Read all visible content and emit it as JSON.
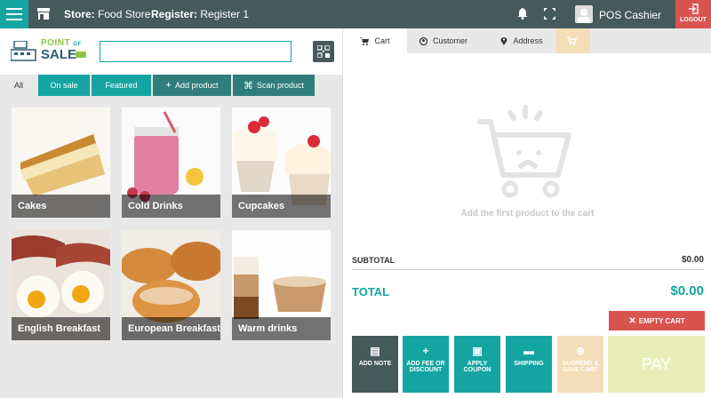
{
  "header": {
    "store_prefix": "Store:",
    "store_name": "Food Store",
    "register_prefix": "Register:",
    "register_name": "Register 1",
    "user_name": "POS Cashier",
    "logout_label": "LOGOUT"
  },
  "logo": {
    "line1": "POINT",
    "line1_small": "OF",
    "line2": "SALE"
  },
  "search": {
    "placeholder": ""
  },
  "category_tabs": [
    {
      "label": "All",
      "icon": ""
    },
    {
      "label": "On sale",
      "icon": ""
    },
    {
      "label": "Featured",
      "icon": ""
    },
    {
      "label": "Add product",
      "icon": "plus-icon"
    },
    {
      "label": "Scan product",
      "icon": "scan-icon"
    }
  ],
  "products": [
    {
      "name": "Cakes"
    },
    {
      "name": "Cold Drinks"
    },
    {
      "name": "Cupcakes"
    },
    {
      "name": "English Breakfast"
    },
    {
      "name": "European Breakfast"
    },
    {
      "name": "Warm drinks"
    }
  ],
  "cart_tabs": [
    {
      "label": "Cart",
      "icon": "cart-icon"
    },
    {
      "label": "Customer",
      "icon": "user-icon"
    },
    {
      "label": "Address",
      "icon": "map-pin-icon"
    },
    {
      "label": "",
      "icon": "saved-cart-icon"
    }
  ],
  "cart": {
    "empty_message": "Add the first product to the cart",
    "subtotal_label": "SUBTOTAL",
    "subtotal_value": "$0.00",
    "total_label": "TOTAL",
    "total_value": "$0.00",
    "empty_cart_label": "EMPTY CART"
  },
  "actions": {
    "note": "ADD NOTE",
    "fee": "ADD FEE OR DISCOUNT",
    "coupon": "APPLY COUPON",
    "shipping": "SHIPPING",
    "suspend": "SUSPEND & SAVE CART",
    "pay": "PAY"
  },
  "colors": {
    "topbar": "#465a5b",
    "accent": "#14a5a2",
    "danger": "#d9534f",
    "disabled_pay": "#e9efb9"
  }
}
